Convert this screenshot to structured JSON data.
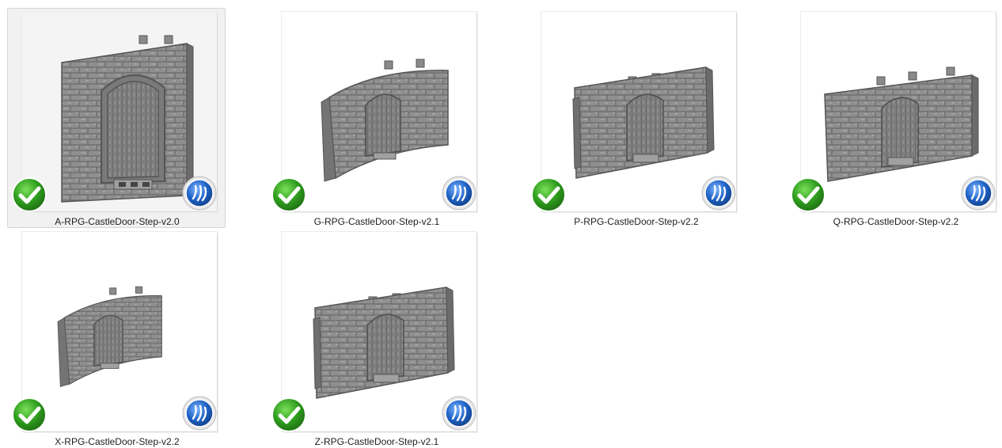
{
  "colors": {
    "selection_bg": "#f1f1f1",
    "stone": "#8e8e8e",
    "check_green": "#2e9c1e",
    "sync_blue": "#1f63c6"
  },
  "files": [
    {
      "name": "A-RPG-CastleDoor-Step-v2.0",
      "selected": true,
      "shape": "flat-large",
      "status_icon": "check-icon",
      "overlay_icon": "sync-icon"
    },
    {
      "name": "G-RPG-CastleDoor-Step-v2.1",
      "selected": false,
      "shape": "curved",
      "status_icon": "check-icon",
      "overlay_icon": "sync-icon"
    },
    {
      "name": "P-RPG-CastleDoor-Step-v2.2",
      "selected": false,
      "shape": "flat-angled",
      "status_icon": "check-icon",
      "overlay_icon": "sync-icon"
    },
    {
      "name": "Q-RPG-CastleDoor-Step-v2.2",
      "selected": false,
      "shape": "flat-wide",
      "status_icon": "check-icon",
      "overlay_icon": "sync-icon"
    },
    {
      "name": "X-RPG-CastleDoor-Step-v2.2",
      "selected": false,
      "shape": "curved-small",
      "status_icon": "check-icon",
      "overlay_icon": "sync-icon"
    },
    {
      "name": "Z-RPG-CastleDoor-Step-v2.1",
      "selected": false,
      "shape": "flat-angled",
      "status_icon": "check-icon",
      "overlay_icon": "sync-icon"
    }
  ]
}
